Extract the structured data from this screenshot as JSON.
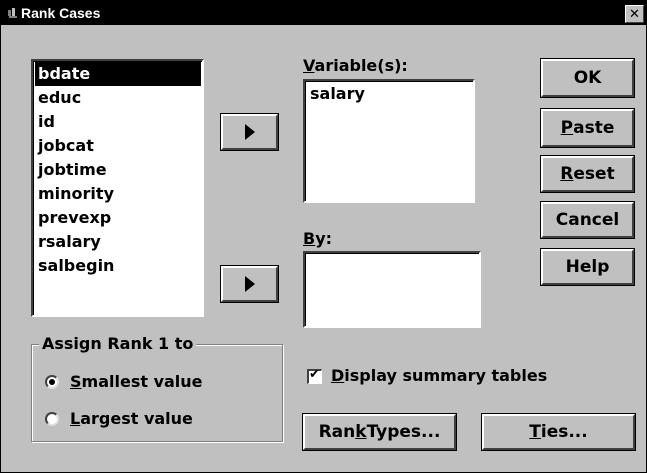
{
  "window": {
    "title": "Rank Cases",
    "close_glyph": "✕"
  },
  "source_list": {
    "items": [
      "bdate",
      "educ",
      "id",
      "jobcat",
      "jobtime",
      "minority",
      "prevexp",
      "rsalary",
      "salbegin"
    ],
    "selected_index": 0
  },
  "variables": {
    "label_underlined": "V",
    "label_rest": "ariable(s):",
    "items": [
      "salary"
    ]
  },
  "by": {
    "label_underlined": "B",
    "label_rest": "y:",
    "items": []
  },
  "buttons": {
    "ok": "OK",
    "paste_u": "P",
    "paste_rest": "aste",
    "reset_u": "R",
    "reset_rest": "eset",
    "cancel": "Cancel",
    "help": "Help",
    "rank_types_pre": "Ran",
    "rank_types_u": "k",
    "rank_types_rest": " Types...",
    "ties_u": "T",
    "ties_rest": "ies..."
  },
  "assign_rank": {
    "title": "Assign Rank 1 to",
    "options": [
      {
        "u": "S",
        "rest": "mallest value",
        "selected": true
      },
      {
        "u": "L",
        "rest": "argest value",
        "selected": false
      }
    ]
  },
  "display_summary": {
    "u": "D",
    "rest": "isplay summary tables",
    "checked": true,
    "check_glyph": "✔"
  },
  "icons": {
    "title_icon": "app-icon",
    "arrow_icon": "right-arrow-icon"
  }
}
